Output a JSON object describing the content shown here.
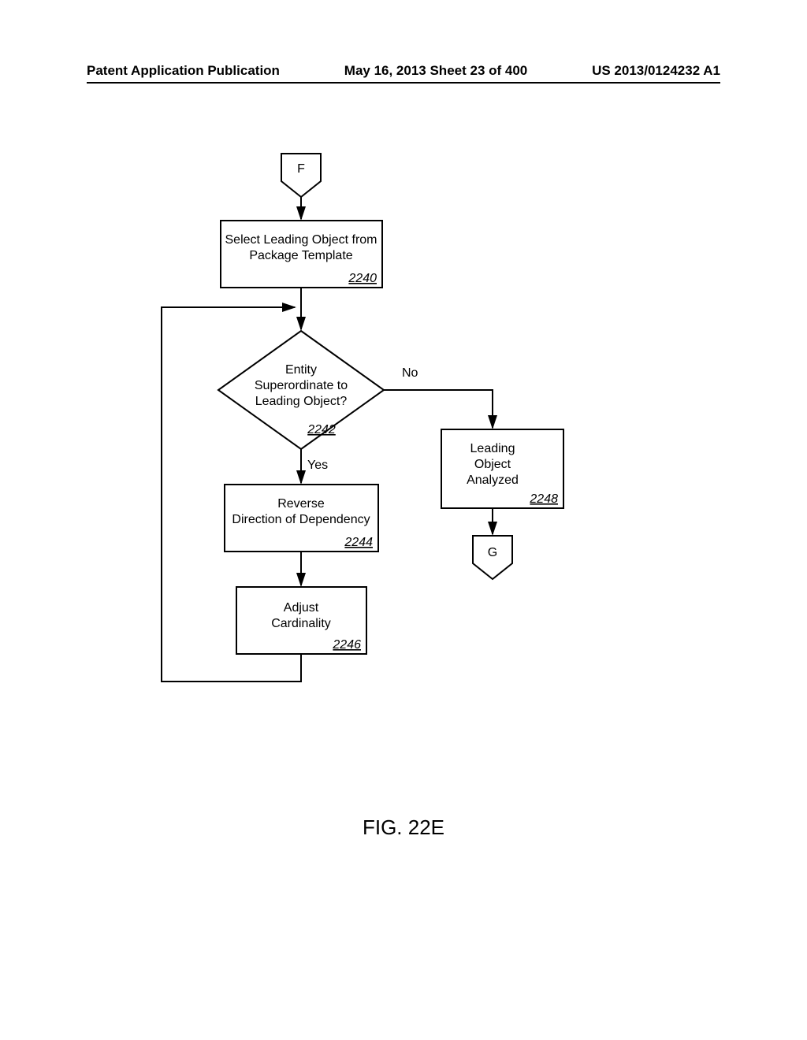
{
  "header": {
    "left": "Patent Application Publication",
    "center": "May 16, 2013  Sheet 23 of 400",
    "right": "US 2013/0124232 A1"
  },
  "connectors": {
    "in": "F",
    "out": "G"
  },
  "nodes": {
    "select": {
      "line1": "Select Leading Object from",
      "line2": "Package Template",
      "ref": "2240"
    },
    "decision": {
      "line1": "Entity",
      "line2": "Superordinate to",
      "line3": "Leading Object?",
      "ref": "2242",
      "yes": "Yes",
      "no": "No"
    },
    "reverse": {
      "line1": "Reverse",
      "line2": "Direction of Dependency",
      "ref": "2244"
    },
    "adjust": {
      "line1": "Adjust",
      "line2": "Cardinality",
      "ref": "2246"
    },
    "analyzed": {
      "line1": "Leading",
      "line2": "Object",
      "line3": "Analyzed",
      "ref": "2248"
    }
  },
  "figure": "FIG. 22E"
}
